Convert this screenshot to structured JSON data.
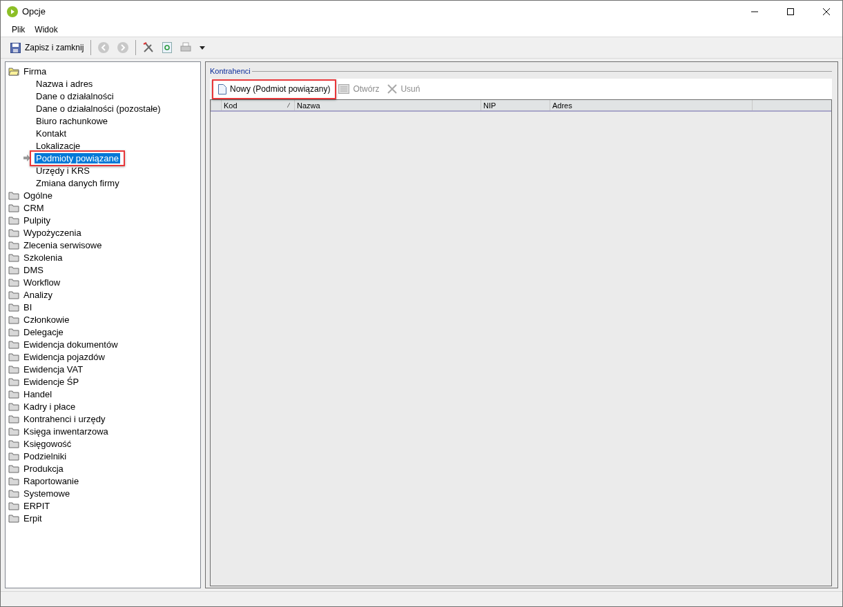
{
  "window": {
    "title": "Opcje"
  },
  "menu": [
    "Plik",
    "Widok"
  ],
  "toolbar": {
    "save_label": "Zapisz i zamknij"
  },
  "tree": [
    {
      "label": "Firma",
      "expanded": true,
      "selected": false,
      "children": [
        {
          "label": "Nazwa i adres",
          "selected": false,
          "highlighted": false
        },
        {
          "label": "Dane o działalności",
          "selected": false,
          "highlighted": false
        },
        {
          "label": "Dane o działalności (pozostałe)",
          "selected": false,
          "highlighted": false
        },
        {
          "label": "Biuro rachunkowe",
          "selected": false,
          "highlighted": false
        },
        {
          "label": "Kontakt",
          "selected": false,
          "highlighted": false
        },
        {
          "label": "Lokalizacje",
          "selected": false,
          "highlighted": false
        },
        {
          "label": "Podmioty powiązane",
          "selected": true,
          "highlighted": true
        },
        {
          "label": "Urzędy i KRS",
          "selected": false,
          "highlighted": false
        },
        {
          "label": "Zmiana danych firmy",
          "selected": false,
          "highlighted": false
        }
      ]
    },
    {
      "label": "Ogólne",
      "expanded": false,
      "selected": false
    },
    {
      "label": "CRM",
      "expanded": false,
      "selected": false
    },
    {
      "label": "Pulpity",
      "expanded": false,
      "selected": false
    },
    {
      "label": "Wypożyczenia",
      "expanded": false,
      "selected": false
    },
    {
      "label": "Zlecenia serwisowe",
      "expanded": false,
      "selected": false
    },
    {
      "label": "Szkolenia",
      "expanded": false,
      "selected": false
    },
    {
      "label": "DMS",
      "expanded": false,
      "selected": false
    },
    {
      "label": "Workflow",
      "expanded": false,
      "selected": false
    },
    {
      "label": "Analizy",
      "expanded": false,
      "selected": false
    },
    {
      "label": "BI",
      "expanded": false,
      "selected": false
    },
    {
      "label": "Członkowie",
      "expanded": false,
      "selected": false
    },
    {
      "label": "Delegacje",
      "expanded": false,
      "selected": false
    },
    {
      "label": "Ewidencja dokumentów",
      "expanded": false,
      "selected": false
    },
    {
      "label": "Ewidencja pojazdów",
      "expanded": false,
      "selected": false
    },
    {
      "label": "Ewidencja VAT",
      "expanded": false,
      "selected": false
    },
    {
      "label": "Ewidencje ŚP",
      "expanded": false,
      "selected": false
    },
    {
      "label": "Handel",
      "expanded": false,
      "selected": false
    },
    {
      "label": "Kadry i płace",
      "expanded": false,
      "selected": false
    },
    {
      "label": "Kontrahenci i urzędy",
      "expanded": false,
      "selected": false
    },
    {
      "label": "Księga inwentarzowa",
      "expanded": false,
      "selected": false
    },
    {
      "label": "Księgowość",
      "expanded": false,
      "selected": false
    },
    {
      "label": "Podzielniki",
      "expanded": false,
      "selected": false
    },
    {
      "label": "Produkcja",
      "expanded": false,
      "selected": false
    },
    {
      "label": "Raportowanie",
      "expanded": false,
      "selected": false
    },
    {
      "label": "Systemowe",
      "expanded": false,
      "selected": false
    },
    {
      "label": "ERPIT",
      "expanded": false,
      "selected": false
    },
    {
      "label": "Erpit",
      "expanded": false,
      "selected": false
    }
  ],
  "group": {
    "title": "Kontrahenci",
    "actions": [
      {
        "kind": "new",
        "label": "Nowy (Podmiot powiązany)",
        "disabled": false,
        "highlighted": true
      },
      {
        "kind": "open",
        "label": "Otwórz",
        "disabled": true,
        "highlighted": false
      },
      {
        "kind": "delete",
        "label": "Usuń",
        "disabled": true,
        "highlighted": false
      }
    ],
    "columns": [
      "Kod",
      "Nazwa",
      "NIP",
      "Adres"
    ]
  }
}
